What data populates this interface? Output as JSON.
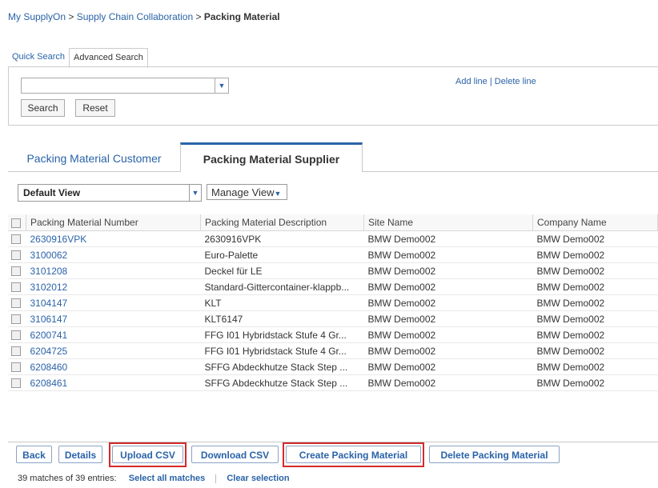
{
  "breadcrumb": {
    "part1": "My SupplyOn",
    "sep1": ">",
    "part2": "Supply Chain Collaboration",
    "sep2": ">",
    "current": "Packing Material"
  },
  "search_tabs": {
    "quick": "Quick Search",
    "advanced": "Advanced Search"
  },
  "search": {
    "combo_value": "",
    "search_label": "Search",
    "reset_label": "Reset",
    "add_line": "Add line",
    "separator": "|",
    "delete_line": "Delete line"
  },
  "main_tabs": {
    "customer": "Packing Material Customer",
    "supplier": "Packing Material Supplier"
  },
  "toolbar": {
    "view": "Default View",
    "manage_view": "Manage View"
  },
  "table": {
    "headers": [
      "Packing Material Number",
      "Packing Material Description",
      "Site Name",
      "Company Name"
    ],
    "rows": [
      [
        "2630916VPK",
        "2630916VPK",
        "BMW Demo002",
        "BMW Demo002"
      ],
      [
        "3100062",
        "Euro-Palette",
        "BMW Demo002",
        "BMW Demo002"
      ],
      [
        "3101208",
        "Deckel für LE",
        "BMW Demo002",
        "BMW Demo002"
      ],
      [
        "3102012",
        "Standard-Gittercontainer-klappb...",
        "BMW Demo002",
        "BMW Demo002"
      ],
      [
        "3104147",
        "KLT",
        "BMW Demo002",
        "BMW Demo002"
      ],
      [
        "3106147",
        "KLT6147",
        "BMW Demo002",
        "BMW Demo002"
      ],
      [
        "6200741",
        "FFG I01 Hybridstack Stufe 4 Gr...",
        "BMW Demo002",
        "BMW Demo002"
      ],
      [
        "6204725",
        "FFG I01 Hybridstack Stufe 4 Gr...",
        "BMW Demo002",
        "BMW Demo002"
      ],
      [
        "6208460",
        "SFFG Abdeckhutze Stack Step ...",
        "BMW Demo002",
        "BMW Demo002"
      ],
      [
        "6208461",
        "SFFG Abdeckhutze Stack Step ...",
        "BMW Demo002",
        "BMW Demo002"
      ]
    ]
  },
  "buttons": {
    "back": "Back",
    "details": "Details",
    "upload_csv": "Upload CSV",
    "download_csv": "Download CSV",
    "create": "Create Packing Material",
    "delete": "Delete Packing Material"
  },
  "status": {
    "matches": "39 matches of 39 entries:",
    "select_all": "Select all matches",
    "clear": "Clear selection"
  },
  "colors": {
    "link": "#2a63a8",
    "highlight": "#d42a2a"
  }
}
